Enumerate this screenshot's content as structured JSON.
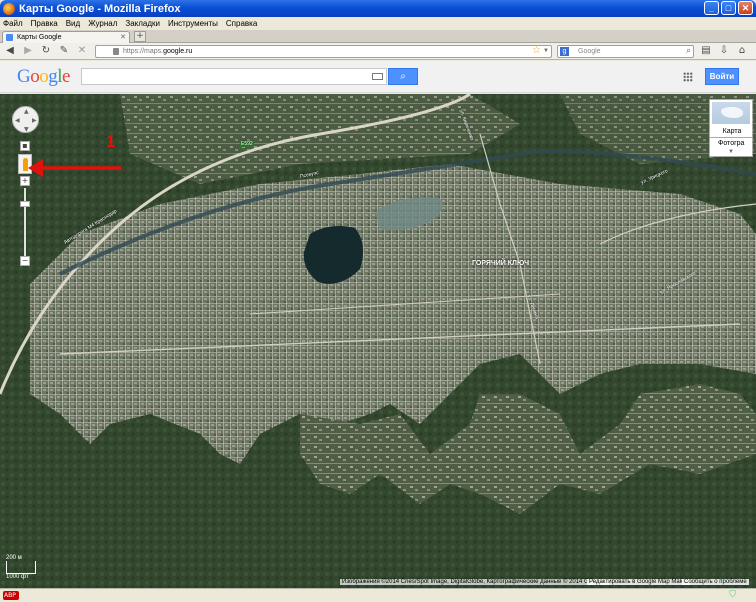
{
  "window": {
    "title": "Карты Google - Mozilla Firefox"
  },
  "menu": [
    "Файл",
    "Правка",
    "Вид",
    "Журнал",
    "Закладки",
    "Инструменты",
    "Справка"
  ],
  "tab": {
    "label": "Карты Google",
    "new_tab": "+"
  },
  "nav": {
    "url_prefix": "https://maps.",
    "url_domain": "google.ru",
    "search_placeholder": "Google"
  },
  "header": {
    "logo": "Google",
    "search_button": "🔍",
    "signin": "Войти"
  },
  "map": {
    "layer_map_label": "Карта",
    "layer_photo_label": "Фотогра",
    "annotation_number": "1",
    "place_labels": [
      "ГОРЯЧИЙ КЛЮЧ",
      "Автодорога М4 Краснодар",
      "ул. Ленина",
      "Псекупс",
      "ул. Кириченко",
      "ул. Урицкого",
      "ул. Ярославского",
      "Е592"
    ],
    "scale_top": "200 м",
    "scale_bottom": "1000 фт",
    "copyright": "Изображения ©2014 Cnes/Spot Image, DigitalGlobe, Картографические данные © 2014 Google -",
    "mapmaker_link": "Редактировать в Google Map Maker",
    "report_link": "Сообщить о проблеме"
  },
  "status": {
    "abp": "ABP"
  }
}
